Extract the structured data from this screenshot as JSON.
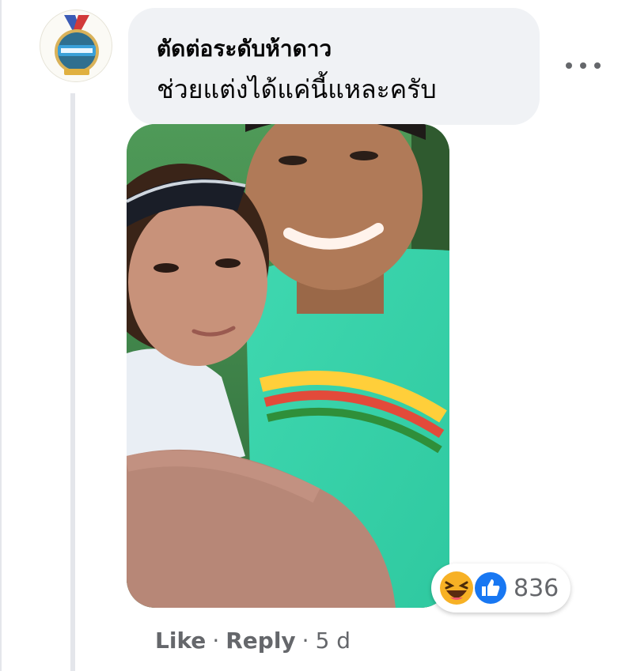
{
  "comment": {
    "author": "ตัดต่อระดับห้าดาว",
    "text": "ช่วยแต่งได้แค่นี้แหละครับ",
    "time": "5 d"
  },
  "reactions": {
    "icons": [
      "haha-icon",
      "like-icon"
    ],
    "count": "836"
  },
  "actions": {
    "like_label": "Like",
    "reply_label": "Reply",
    "separator": "·"
  },
  "colors": {
    "bubble": "#f0f2f5",
    "text": "#050505",
    "secondary": "#65676b",
    "like_blue": "#1877f2",
    "haha_yellow": "#f7b125"
  }
}
